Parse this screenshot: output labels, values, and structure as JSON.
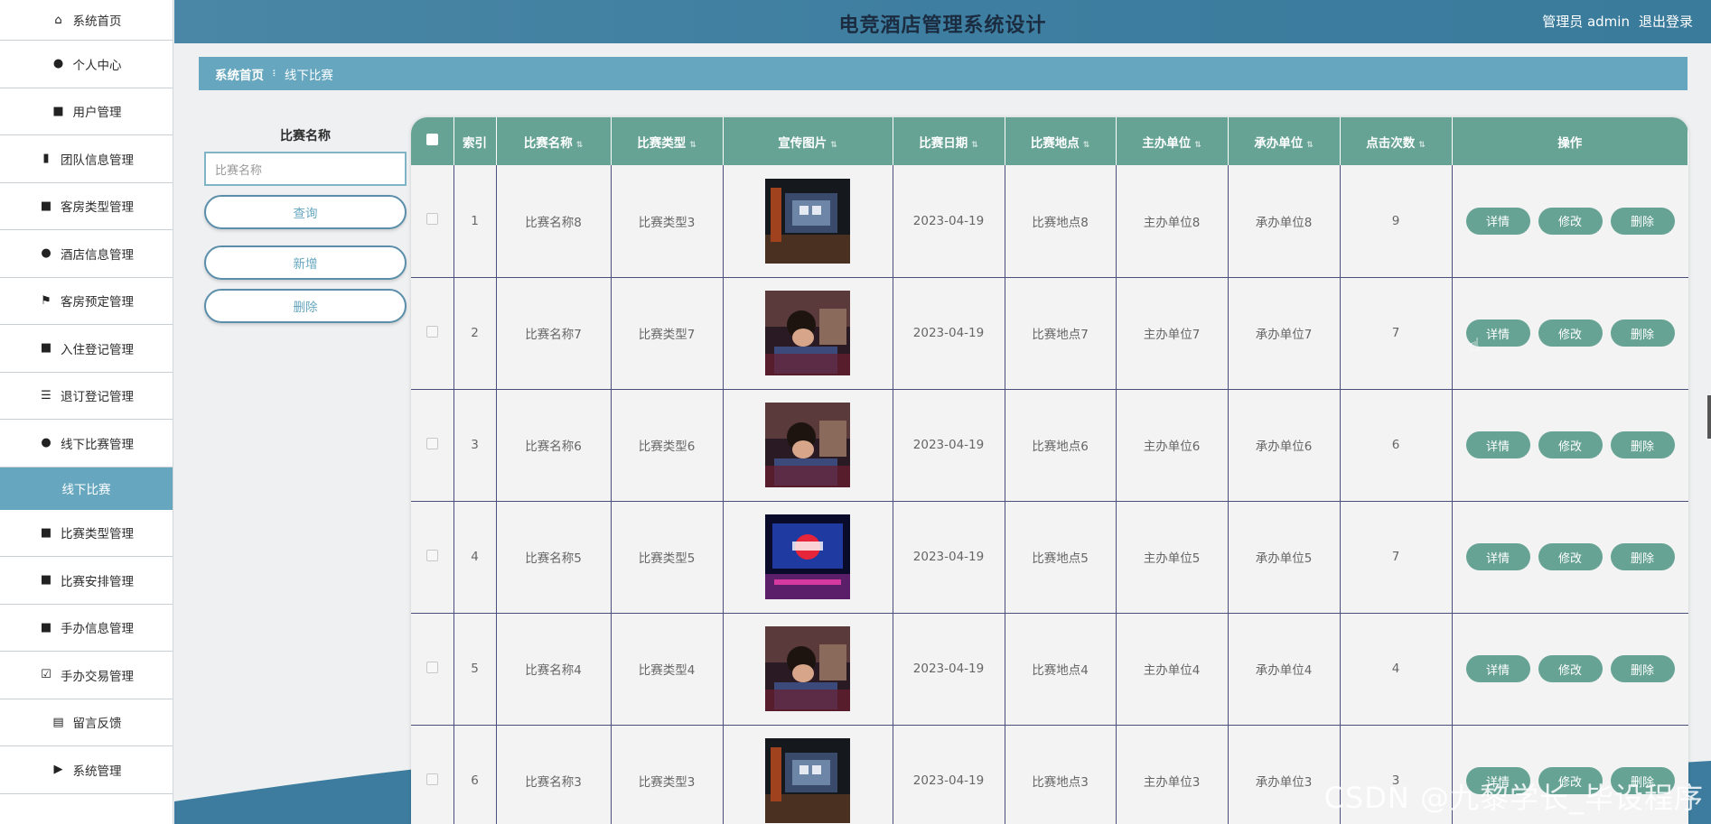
{
  "app": {
    "title": "电竞酒店管理系统设计",
    "user_label": "管理员 admin",
    "logout_label": "退出登录"
  },
  "sidebar": {
    "items": [
      {
        "label": "系统首页",
        "icon": "home-icon",
        "glyph": "⌂"
      },
      {
        "label": "个人中心",
        "icon": "user-icon",
        "glyph": "●"
      },
      {
        "label": "用户管理",
        "icon": "grid-icon",
        "glyph": "■"
      },
      {
        "label": "团队信息管理",
        "icon": "bar-chart-icon",
        "glyph": "▮"
      },
      {
        "label": "客房类型管理",
        "icon": "grid-icon",
        "glyph": "■"
      },
      {
        "label": "酒店信息管理",
        "icon": "bulb-icon",
        "glyph": "●"
      },
      {
        "label": "客房预定管理",
        "icon": "flag-icon",
        "glyph": "⚑"
      },
      {
        "label": "入住登记管理",
        "icon": "grid-icon",
        "glyph": "■"
      },
      {
        "label": "退订登记管理",
        "icon": "list-icon",
        "glyph": "☰"
      },
      {
        "label": "线下比赛管理",
        "icon": "user-icon",
        "glyph": "●"
      },
      {
        "label": "线下比赛",
        "icon": "",
        "glyph": ""
      },
      {
        "label": "比赛类型管理",
        "icon": "briefcase-icon",
        "glyph": "■"
      },
      {
        "label": "比赛安排管理",
        "icon": "grid-icon",
        "glyph": "■"
      },
      {
        "label": "手办信息管理",
        "icon": "grid-icon",
        "glyph": "■"
      },
      {
        "label": "手办交易管理",
        "icon": "clipboard-check-icon",
        "glyph": "☑"
      },
      {
        "label": "留言反馈",
        "icon": "clipboard-icon",
        "glyph": "▤"
      },
      {
        "label": "系统管理",
        "icon": "video-icon",
        "glyph": "▶"
      }
    ]
  },
  "breadcrumb": {
    "home": "系统首页",
    "separator": "፧",
    "current": "线下比赛"
  },
  "search": {
    "label": "比赛名称",
    "placeholder": "比赛名称",
    "query_btn": "查询",
    "add_btn": "新增",
    "delete_btn": "删除"
  },
  "table": {
    "columns": [
      "索引",
      "比赛名称",
      "比赛类型",
      "宣传图片",
      "比赛日期",
      "比赛地点",
      "主办单位",
      "承办单位",
      "点击次数",
      "操作"
    ],
    "rows": [
      {
        "index": "1",
        "name": "比赛名称8",
        "type": "比赛类型3",
        "date": "2023-04-19",
        "place": "比赛地点8",
        "host": "主办单位8",
        "org": "承办单位8",
        "clicks": "9",
        "img": "screen"
      },
      {
        "index": "2",
        "name": "比赛名称7",
        "type": "比赛类型7",
        "date": "2023-04-19",
        "place": "比赛地点7",
        "host": "主办单位7",
        "org": "承办单位7",
        "clicks": "7",
        "img": "player"
      },
      {
        "index": "3",
        "name": "比赛名称6",
        "type": "比赛类型6",
        "date": "2023-04-19",
        "place": "比赛地点6",
        "host": "主办单位6",
        "org": "承办单位6",
        "clicks": "6",
        "img": "player"
      },
      {
        "index": "4",
        "name": "比赛名称5",
        "type": "比赛类型5",
        "date": "2023-04-19",
        "place": "比赛地点5",
        "host": "主办单位5",
        "org": "承办单位5",
        "clicks": "7",
        "img": "stage"
      },
      {
        "index": "5",
        "name": "比赛名称4",
        "type": "比赛类型4",
        "date": "2023-04-19",
        "place": "比赛地点4",
        "host": "主办单位4",
        "org": "承办单位4",
        "clicks": "4",
        "img": "player"
      },
      {
        "index": "6",
        "name": "比赛名称3",
        "type": "比赛类型3",
        "date": "2023-04-19",
        "place": "比赛地点3",
        "host": "主办单位3",
        "org": "承办单位3",
        "clicks": "3",
        "img": "screen"
      }
    ],
    "actions": {
      "detail": "详情",
      "edit": "修改",
      "delete": "删除"
    }
  },
  "watermark": "CSDN @九黎学长_毕设程序",
  "colors": {
    "header": "#3e7ea0",
    "accent": "#66a7bf",
    "table_header": "#66a394",
    "action_button": "#66a394"
  }
}
